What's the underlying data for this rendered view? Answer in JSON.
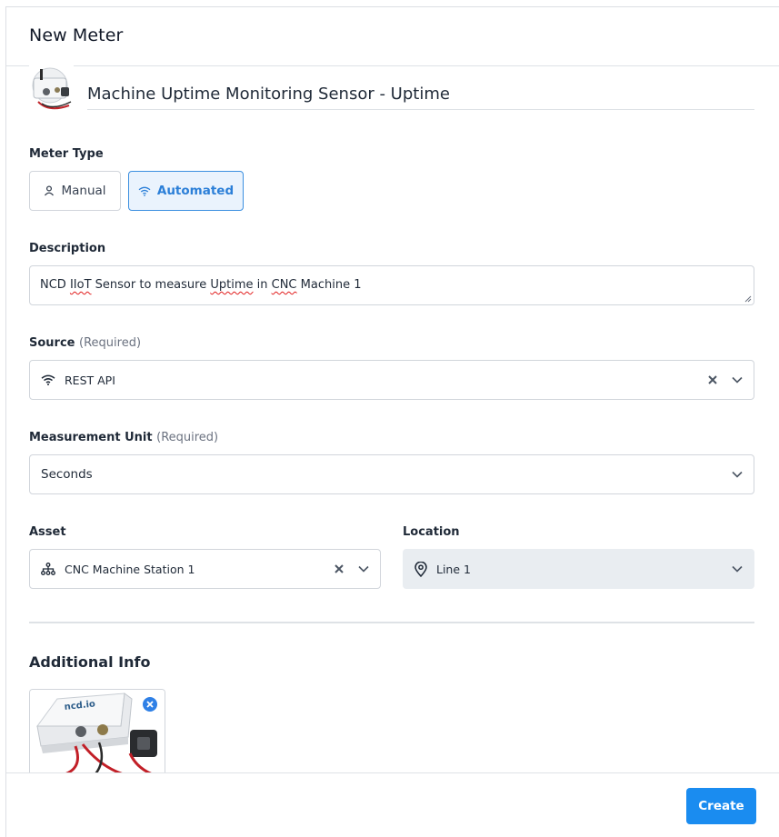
{
  "header": {
    "title": "New Meter"
  },
  "meter": {
    "name": "Machine Uptime Monitoring Sensor - Uptime",
    "thumbnail_icon": "sensor-device-image"
  },
  "meter_type": {
    "label": "Meter Type",
    "options": [
      {
        "label": "Manual",
        "icon": "person-icon",
        "selected": false
      },
      {
        "label": "Automated",
        "icon": "wifi-icon",
        "selected": true
      }
    ]
  },
  "description": {
    "label": "Description",
    "parts": [
      "NCD ",
      "IIoT",
      " Sensor to measure ",
      "Uptime",
      " in ",
      "CNC",
      " Machine 1"
    ]
  },
  "source": {
    "label": "Source",
    "required": "(Required)",
    "value": "REST API",
    "icon": "wifi-icon"
  },
  "unit": {
    "label": "Measurement Unit",
    "required": "(Required)",
    "value": "Seconds"
  },
  "asset": {
    "label": "Asset",
    "value": "CNC Machine Station 1",
    "icon": "hierarchy-icon"
  },
  "location": {
    "label": "Location",
    "value": "Line 1",
    "icon": "map-pin-icon"
  },
  "additional": {
    "title": "Additional Info",
    "image_icon": "sensor-device-image",
    "remove_icon": "close-icon"
  },
  "footer": {
    "create_label": "Create"
  },
  "colors": {
    "accent": "#1a8cf0",
    "active_bg": "#eaf3fd",
    "active_border": "#3b8fe0",
    "spell_error": "#e11d1d"
  }
}
